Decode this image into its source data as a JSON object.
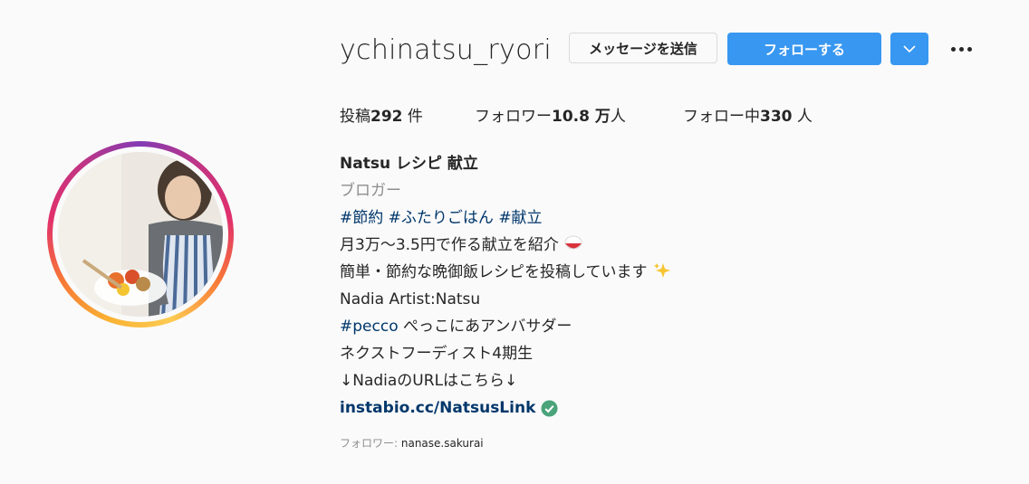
{
  "profile": {
    "username": "ychinatsu_ryori",
    "message_button": "メッセージを送信",
    "follow_button": "フォローする"
  },
  "stats": {
    "posts_label": "投稿",
    "posts_count": "292",
    "posts_unit": " 件",
    "followers_label": "フォロワー",
    "followers_count": "10.8 万",
    "followers_unit": "人",
    "following_label": "フォロー中",
    "following_count": "330",
    "following_unit": " 人"
  },
  "bio": {
    "full_name": "Natsu レシピ 献立",
    "category": "ブロガー",
    "hashtag_1": "#節約",
    "hashtag_2": "#ふたりごはん",
    "hashtag_3": "#献立",
    "line_1": "月3万〜3.5円で作る献立を紹介",
    "line_2": "簡単・節約な晩御飯レシピを投稿しています",
    "line_3": "Nadia Artist:Natsu",
    "pecco_tag": "#pecco",
    "pecco_text": " ぺっこにあアンバサダー",
    "line_5": "ネクストフーディスト4期生",
    "line_6": "↓NadiaのURLはこちら↓",
    "link": "instabio.cc/NatsusLink"
  },
  "followed_by": {
    "label": "フォロワー: ",
    "user": "nanase.sakurai"
  },
  "colors": {
    "primary": "#3897f0",
    "link": "#00376b",
    "muted": "#8e8e8e",
    "verified": "#4aa37a"
  },
  "icons": [
    "chevron-down-icon",
    "more-options-icon",
    "rice-bowl-emoji-icon",
    "sparkles-emoji-icon",
    "verified-check-icon"
  ]
}
